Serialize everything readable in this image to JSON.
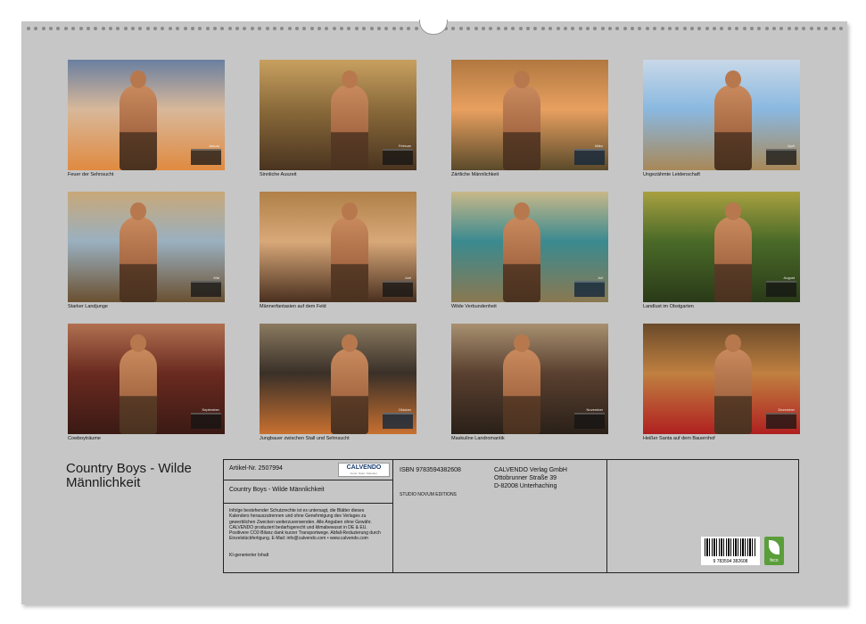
{
  "months": [
    {
      "caption": "Feuer der Sehnsucht",
      "month_label": "Januar",
      "colors": [
        "#d8b89a",
        "#6a7fa0",
        "#e08a40"
      ]
    },
    {
      "caption": "Sinnliche Auszeit",
      "month_label": "Februar",
      "colors": [
        "#8a6a3a",
        "#c8a060",
        "#4a3420"
      ]
    },
    {
      "caption": "Zärtliche Männlichkeit",
      "month_label": "März",
      "colors": [
        "#e8a060",
        "#b07840",
        "#5a4a2a"
      ]
    },
    {
      "caption": "Ungezähmte Leidenschaft",
      "month_label": "April",
      "colors": [
        "#8ab8e0",
        "#c8d8e8",
        "#a88858"
      ]
    },
    {
      "caption": "Starker Landjunge",
      "month_label": "Mai",
      "colors": [
        "#9ab0c0",
        "#c8a878",
        "#6a5030"
      ]
    },
    {
      "caption": "Männerfantasien auf dem Feld",
      "month_label": "Juni",
      "colors": [
        "#d8a878",
        "#b08048",
        "#4a3020"
      ]
    },
    {
      "caption": "Wilde Verbundenheit",
      "month_label": "Juli",
      "colors": [
        "#3a8a90",
        "#c8b888",
        "#8a7850"
      ]
    },
    {
      "caption": "Landlust im Obstgarten",
      "month_label": "August",
      "colors": [
        "#4a6a28",
        "#a8a040",
        "#2a3a18"
      ]
    },
    {
      "caption": "Cowboyträume",
      "month_label": "September",
      "colors": [
        "#6a2a20",
        "#b07050",
        "#3a1a14"
      ]
    },
    {
      "caption": "Jungbauer zwischen Stall und Sehnsucht",
      "month_label": "Oktober",
      "colors": [
        "#3a3028",
        "#8a7a60",
        "#c87030"
      ]
    },
    {
      "caption": "Maskuline Landromantik",
      "month_label": "November",
      "colors": [
        "#5a4030",
        "#a89070",
        "#2a2018"
      ]
    },
    {
      "caption": "Heißer Santa auf dem Bauernhof",
      "month_label": "Dezember",
      "colors": [
        "#c08040",
        "#6a4a2a",
        "#b02020"
      ]
    }
  ],
  "title": "Country Boys - Wilde Männlichkeit",
  "info": {
    "article": "Artikel-Nr. 2507994",
    "logo": "CALVENDO",
    "logo_sub": "Kunst. Natur. Kalender.",
    "product_title": "Country Boys - Wilde Männlichkeit",
    "legal": "Infolge bestehender Schutzrechte ist es untersagt, die Blätter dieses Kalenders herauszutrennen und ohne Genehmigung des Verlages zu gewerblichen Zwecken weiterzuverwenden. Alle Angaben ohne Gewähr. CALVENDO produziert bedarfsgerecht und klimabewusst in DE & EU. Positivere CO2-Bilanz dank kurzer Transportwege. Abfall-Reduzierung durch Einzelstückfertigung. E-Mail: info@calvendo.com • www.calvendo.com",
    "ki": "KI-generierter Inhalt",
    "isbn": "ISBN 9783594382608",
    "author": "STUDIO NOVUM EDITIONS",
    "publisher_lines": [
      "CALVENDO Verlag GmbH",
      "Ottobrunner Straße 39",
      "D-82008 Unterhaching"
    ],
    "barcode_number": "9 783594 382608",
    "eco_label": "feco"
  }
}
